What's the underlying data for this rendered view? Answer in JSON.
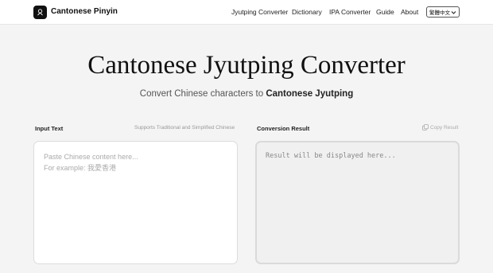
{
  "header": {
    "brand": "Cantonese Pinyin",
    "nav": [
      {
        "label": "Jyutping Converter"
      },
      {
        "label": "Dictionary"
      },
      {
        "label": "IPA Converter"
      },
      {
        "label": "Guide"
      },
      {
        "label": "About"
      }
    ],
    "language": "繁體中文",
    "logo_icon": "cantonese-logo-icon"
  },
  "hero": {
    "title": "Cantonese Jyutping Converter",
    "subtitle_prefix": "Convert Chinese characters to ",
    "subtitle_bold": "Cantonese Jyutping"
  },
  "input_panel": {
    "label": "Input Text",
    "hint": "Supports Traditional and Simplified Chinese",
    "placeholder_line1": "Paste Chinese content here...",
    "placeholder_line2": "For example: 我愛香港"
  },
  "output_panel": {
    "label": "Conversion Result",
    "copy_label": "Copy Result",
    "placeholder": "Result will be displayed here..."
  }
}
